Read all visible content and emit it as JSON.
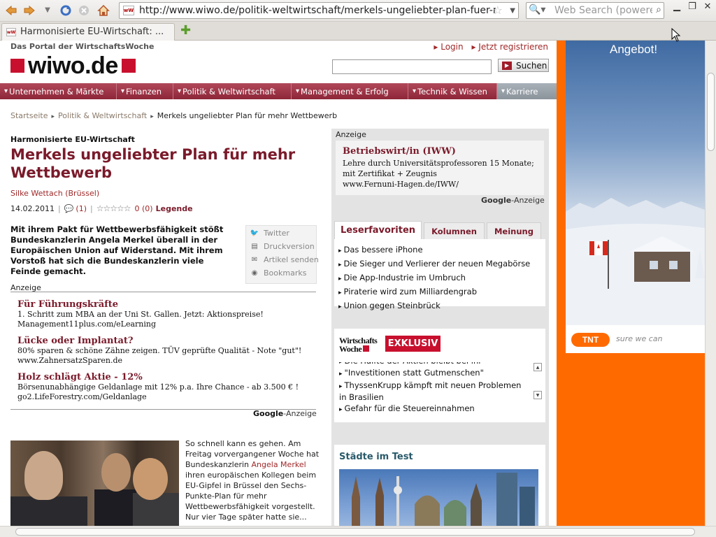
{
  "browser": {
    "url": "http://www.wiwo.de/politik-weltwirtschaft/merkels-ungeliebter-plan-fuer-meh",
    "search_placeholder": "Web Search (powere",
    "tab_title": "Harmonisierte EU-Wirtschaft: ...",
    "favicon_text": "wW"
  },
  "site": {
    "portal_label": "Das Portal der WirtschaftsWoche",
    "logo_text": "wiwo.de",
    "login": "Login",
    "register": "Jetzt registrieren",
    "search_button": "Suchen",
    "nav": [
      "Unternehmen & Märkte",
      "Finanzen",
      "Politik & Weltwirtschaft",
      "Management & Erfolg",
      "Technik & Wissen",
      "Karriere"
    ],
    "breadcrumb": [
      "Startseite",
      "Politik & Weltwirtschaft",
      "Merkels ungeliebter Plan für mehr Wettbewerb"
    ]
  },
  "article": {
    "kicker": "Harmonisierte EU-Wirtschaft",
    "headline": "Merkels ungeliebter Plan für mehr Wettbewerb",
    "author": "Silke Wettach (Brüssel)",
    "date": "14.02.2011",
    "comments": "(1)",
    "rating": "0 (0)",
    "legend": "Legende",
    "lead": "Mit ihrem Pakt für Wettbewerbsfähigkeit stößt Bundeskanzlerin Angela Merkel überall in der Europäischen Union auf Widerstand. Mit ihrem Vorstoß hat sich die Bundeskanzlerin viele Feinde gemacht.",
    "share": [
      "Twitter",
      "Druckversion",
      "Artikel senden",
      "Bookmarks"
    ],
    "ad_label": "Anzeige",
    "ads": [
      {
        "title": "Für Führungskräfte",
        "text": "1. Schritt zum MBA an der Uni St. Gallen. Jetzt: Aktionspreise!",
        "url": "Management11plus.com/eLearning"
      },
      {
        "title": "Lücke oder Implantat?",
        "text": "80% sparen & schöne Zähne zeigen. TÜV geprüfte Qualität - Note \"gut\"!",
        "url": "www.ZahnersatzSparen.de"
      },
      {
        "title": "Holz schlägt Aktie - 12%",
        "text": "Börsenunabhängige Geldanlage mit 12% p.a. Ihre Chance - ab 3.500 € !",
        "url": "go2.LifeForestry.com/Geldanlage"
      }
    ],
    "google_ads": [
      "Google",
      "-Anzeige"
    ],
    "body_start": "So schnell kann es gehen. Am Freitag vorvergangener Woche hat Bundeskanzlerin ",
    "body_link": "Angela Merkel",
    "body_rest": " ihren europäischen Kollegen beim EU-Gipfel in Brüssel den Sechs-Punkte-Plan für mehr Wettbewerbsfähigkeit vorgestellt. Nur vier Tage später hatte sie..."
  },
  "sidebar": {
    "ad_label": "Anzeige",
    "ad": {
      "title": "Betriebswirt/in (IWW)",
      "text": "Lehre durch Universitätsprofessoren 15 Monate; mit Zertifikat + Zeugnis",
      "url": "www.Fernuni-Hagen.de/IWW/"
    },
    "google_ads": [
      "Google",
      "-Anzeige"
    ],
    "tabs": [
      "Leserfavoriten",
      "Kolumnen",
      "Meinung"
    ],
    "favorites": [
      "Das bessere iPhone",
      "Die Sieger und Verlierer der neuen Megabörse",
      "Die App-Industrie im Umbruch",
      "Piraterie wird zum Milliardengrab",
      "Union gegen Steinbrück"
    ],
    "exklusiv_logo": [
      "Wirtschafts",
      "Woche"
    ],
    "exklusiv_label": "EXKLUSIV",
    "exklusiv_items": [
      "Die Hälfte der Aktien bleibt bei ihr",
      "\"Investitionen statt Gutmenschen\"",
      "ThyssenKrupp kämpft mit neuen Problemen in Brasilien",
      "Gefahr für die Steuereinnahmen"
    ],
    "cities_title": "Städte im Test"
  },
  "banner": {
    "headline": "Angebot!",
    "brand": "TNT",
    "slogan": "sure we can"
  }
}
